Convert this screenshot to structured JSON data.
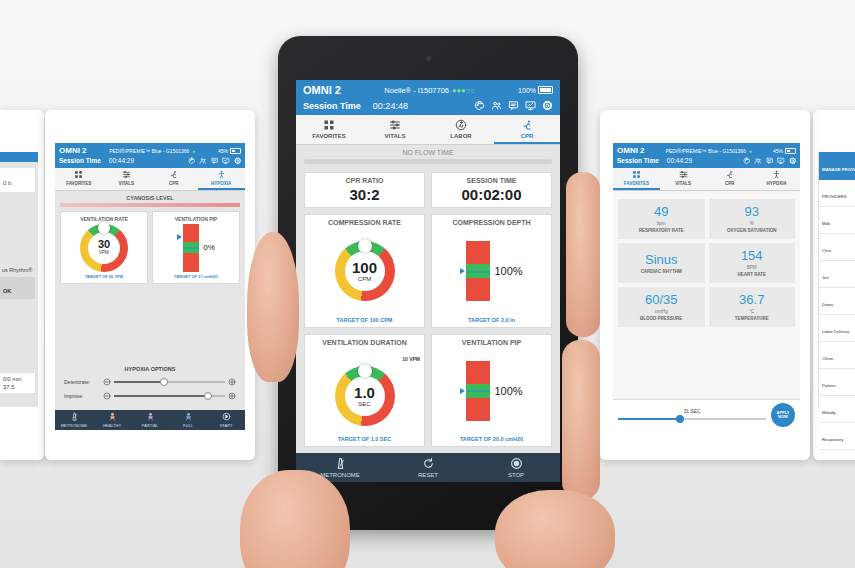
{
  "center": {
    "header": {
      "product": "OMNI 2",
      "device": "Noelle® - I1507706",
      "signal": "●●●○○",
      "battery": "100%",
      "battery_level": 1,
      "session_label": "Session Time",
      "session_time": "00:24:48"
    },
    "tabs": [
      {
        "label": "FAVORITES",
        "selected": false
      },
      {
        "label": "VITALS",
        "selected": false
      },
      {
        "label": "LABOR",
        "selected": false
      },
      {
        "label": "CPR",
        "selected": true
      }
    ],
    "no_flow": {
      "label": "NO FLOW TIME",
      "level": 0
    },
    "cards": [
      {
        "kind": "text",
        "title": "CPR RATIO",
        "value": "30:2"
      },
      {
        "kind": "text",
        "title": "SESSION TIME",
        "value": "00:02:00"
      },
      {
        "kind": "gauge",
        "title": "COMPRESSION RATE",
        "value": "100",
        "unit": "CPM",
        "target": "TARGET OF 100 CPM",
        "level": 0.5
      },
      {
        "kind": "bar",
        "title": "COMPRESSION DEPTH",
        "reading": "100%",
        "target": "TARGET OF 2.0 in",
        "level": 0.5
      },
      {
        "kind": "gauge",
        "title": "VENTILATION DURATION",
        "badge": "10 VPM",
        "value": "1.0",
        "unit": "SEC",
        "target": "TARGET OF 1.0 SEC",
        "level": 0.5
      },
      {
        "kind": "bar",
        "title": "VENTILATION PIP",
        "reading": "100%",
        "target": "TARGET OF 20.0 cmH20",
        "level": 0.5
      }
    ],
    "buttons": [
      {
        "label": "METRONOME"
      },
      {
        "label": "RESET"
      },
      {
        "label": "STOP"
      }
    ]
  },
  "left": {
    "header": {
      "product": "OMNI 2",
      "device": "PEDI®/PREMIE™ Blue - G1501366",
      "signal": "●",
      "battery": "45%",
      "battery_level": 0.45,
      "session_label": "Session Time",
      "session_time": "00:44:29"
    },
    "tabs": [
      {
        "label": "FAVORITES",
        "selected": false
      },
      {
        "label": "VITALS",
        "selected": false
      },
      {
        "label": "CPR",
        "selected": false
      },
      {
        "label": "HYPOXIA",
        "selected": true
      }
    ],
    "cyanosis": {
      "label": "CYANOSIS LEVEL",
      "level": 1
    },
    "cards": [
      {
        "kind": "gauge",
        "title": "VENTILATION RATE",
        "value": "30",
        "unit": "VPM",
        "target": "TARGET OF 60 VPM",
        "level": 0.5
      },
      {
        "kind": "bar",
        "title": "VENTILATION PIP",
        "reading": "0%",
        "target": "TARGET OF 17 cmH2O",
        "level": 0.72
      }
    ],
    "options_title": "HYPOXIA OPTIONS",
    "sliders": [
      {
        "label": "Deteriorate:",
        "level": 0.45
      },
      {
        "label": "Improve:",
        "level": 0.85
      }
    ],
    "buttons": [
      {
        "label": "METRONOME"
      },
      {
        "label": "HEALTHY"
      },
      {
        "label": "PARTIAL"
      },
      {
        "label": "FULL"
      },
      {
        "label": "START"
      }
    ]
  },
  "right": {
    "header": {
      "product": "OMNI 2",
      "device": "PEDI®/PREMIE™ Blue - G1501366",
      "signal": "●",
      "battery": "45%",
      "battery_level": 0.45,
      "session_label": "Session Time",
      "session_time": "00:44:29"
    },
    "tabs": [
      {
        "label": "FAVORITES",
        "selected": true
      },
      {
        "label": "VITALS",
        "selected": false
      },
      {
        "label": "CPR",
        "selected": false
      },
      {
        "label": "HYPOXIA",
        "selected": false
      }
    ],
    "vitals": [
      {
        "value": "49",
        "unit": "bpm",
        "label": "RESPIRATORY RATE"
      },
      {
        "value": "93",
        "unit": "%",
        "label": "OXYGEN SATURATION"
      },
      {
        "value": "Sinus",
        "label": "CARDIAC RHYTHM"
      },
      {
        "value": "154",
        "unit": "BPM",
        "label": "HEART RATE"
      },
      {
        "value": "60/35",
        "unit": "mmHg",
        "label": "BLOOD PRESSURE"
      },
      {
        "value": "36.7",
        "unit": "°C",
        "label": "TEMPERATURE"
      }
    ],
    "duration": {
      "reading": "31 SEC",
      "level": 0.42
    },
    "apply": "APPLY NOW"
  },
  "edge_left": {
    "field": "0 b",
    "rhythm": "us Rhythm®",
    "ok": "OK",
    "pressure": "0/0 mm",
    "temperature": "37.5"
  },
  "edge_right": {
    "title": "MANAGE PROVI",
    "items": [
      "PROVIDERS",
      "Mild",
      "Chro",
      "Jen",
      "Dama",
      "Labor Delivery",
      "Chron",
      "Pattern",
      "Melody",
      "Respiratory"
    ]
  }
}
